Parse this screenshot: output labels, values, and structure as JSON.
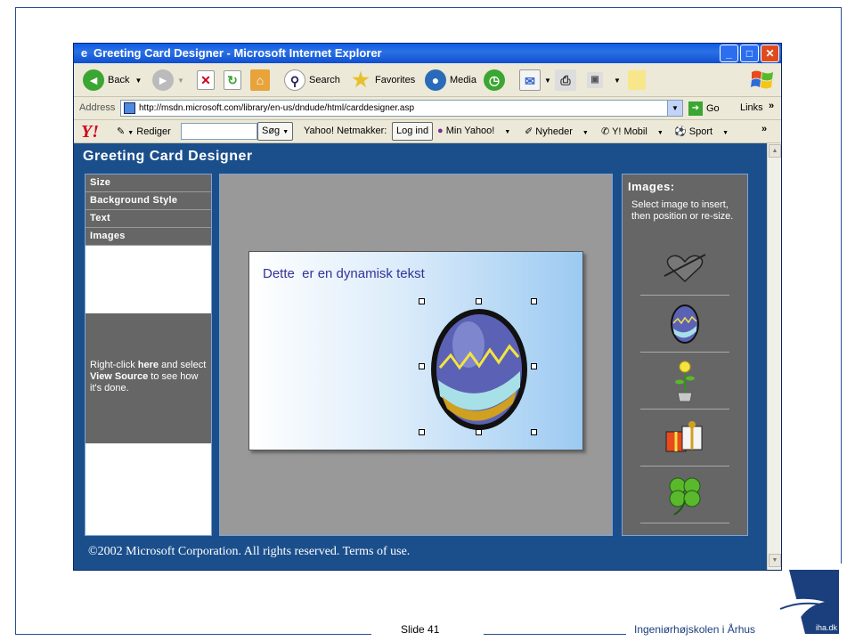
{
  "window": {
    "title": "Greeting Card Designer - Microsoft Internet Explorer",
    "min": "_",
    "max": "□",
    "close": "✕"
  },
  "toolbar": {
    "back": "Back",
    "search": "Search",
    "favorites": "Favorites",
    "media": "Media"
  },
  "address": {
    "label": "Address",
    "url": "http://msdn.microsoft.com/library/en-us/dndude/html/carddesigner.asp",
    "go": "Go",
    "links": "Links"
  },
  "yahoo": {
    "logo": "Y!",
    "rediger": "Rediger",
    "sog": "Søg",
    "netmakker": "Yahoo! Netmakker:",
    "login": "Log ind",
    "myyahoo": "Min Yahoo!",
    "nyheder": "Nyheder",
    "mobil": "Y! Mobil",
    "sport": "Sport"
  },
  "app": {
    "title": "Greeting Card Designer",
    "nav": [
      "Size",
      "Background Style",
      "Text",
      "Images"
    ],
    "info_pre": "Right-click ",
    "info_here": "here",
    "info_mid": " and select ",
    "info_vs": "View Source",
    "info_post": " to see how it's done.",
    "card_text": "Dette  er en dynamisk tekst",
    "images_title": "Images:",
    "images_help": "Select image to insert, then position or re-size.",
    "copyright": "©2002 Microsoft Corporation. All rights reserved. Terms of use."
  },
  "slide": {
    "number": "Slide 41",
    "school": "Ingeniørhøjskolen i Århus",
    "logo_text": "iha.dk"
  },
  "colors": {
    "page_bg": "#1b4f8c",
    "panel_gray": "#666666",
    "egg_blue": "#5b62b5"
  }
}
